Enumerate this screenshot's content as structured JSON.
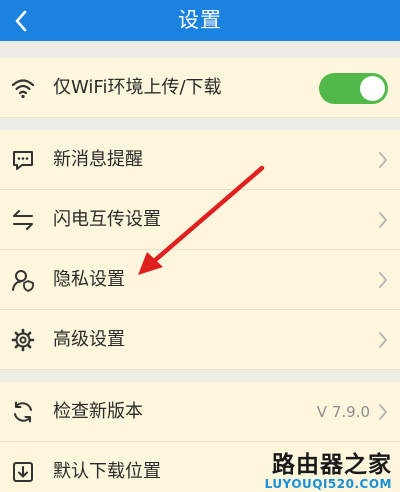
{
  "header": {
    "title": "设置",
    "back_icon": "chevron-left-icon"
  },
  "colors": {
    "header_bg": "#1b82e0",
    "row_bg": "#fbf6dc",
    "toggle_on": "#52b84a",
    "arrow": "#e02020"
  },
  "settings": {
    "wifi_only": {
      "label": "仅WiFi环境上传/下载",
      "icon": "wifi-icon",
      "toggle_on": true
    },
    "items": [
      {
        "label": "新消息提醒",
        "icon": "message-icon"
      },
      {
        "label": "闪电互传设置",
        "icon": "transfer-arrows-icon"
      },
      {
        "label": "隐私设置",
        "icon": "privacy-user-icon"
      },
      {
        "label": "高级设置",
        "icon": "gear-icon"
      }
    ],
    "check_update": {
      "label": "检查新版本",
      "icon": "refresh-icon",
      "version": "V 7.9.0"
    },
    "download_location": {
      "label": "默认下载位置",
      "icon": "download-icon"
    }
  },
  "watermark": {
    "title": "路由器之家",
    "url": "LUYOUQI520.COM"
  }
}
